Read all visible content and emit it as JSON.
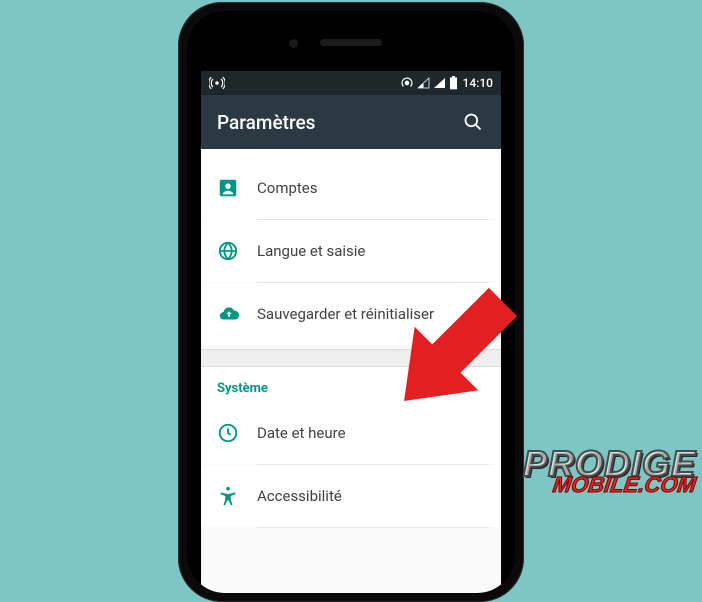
{
  "status": {
    "time": "14:10"
  },
  "appbar": {
    "title": "Paramètres"
  },
  "items": {
    "accounts": "Comptes",
    "language": "Langue et saisie",
    "backup": "Sauvegarder et réinitialiser",
    "datetime": "Date et heure",
    "accessibility": "Accessibilité"
  },
  "section": {
    "system": "Système"
  },
  "watermark": {
    "top": "PRODIGE",
    "bot": "MOBILE.COM"
  }
}
